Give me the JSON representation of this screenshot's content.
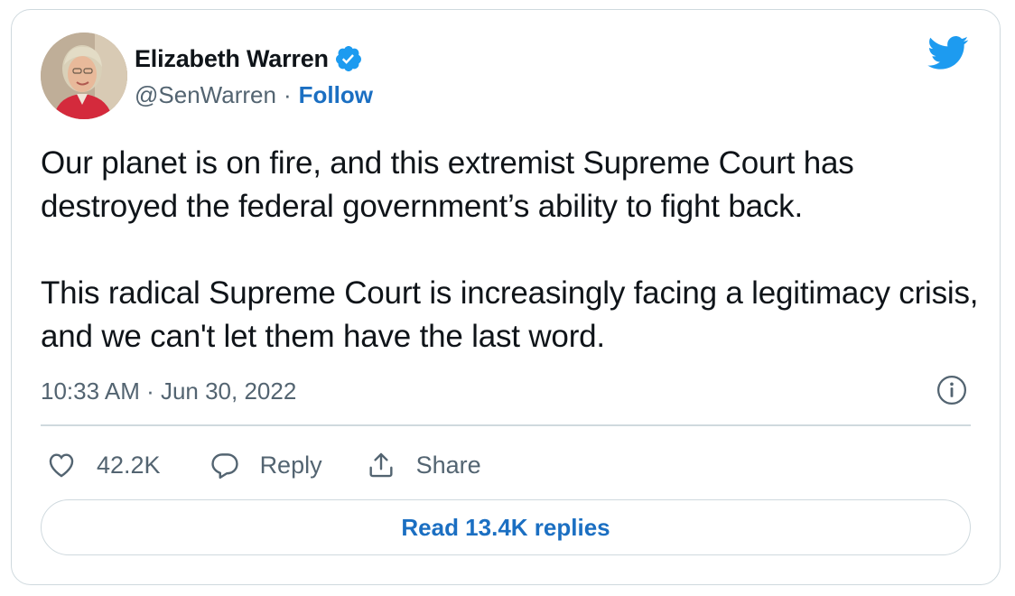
{
  "author": {
    "name": "Elizabeth Warren",
    "handle": "@SenWarren",
    "separator": "·",
    "follow_label": "Follow",
    "verified": true,
    "avatar_icon": "profile-photo"
  },
  "tweet": {
    "paragraphs": [
      "Our planet is on fire, and this extremist Supreme Court has destroyed the federal government’s ability to fight back.",
      "This radical Supreme Court is increasingly facing a legitimacy crisis, and we can't let them have the last word."
    ],
    "timestamp": "10:33 AM · Jun 30, 2022"
  },
  "actions": {
    "like_count": "42.2K",
    "reply_label": "Reply",
    "share_label": "Share"
  },
  "read_replies_label": "Read 13.4K replies",
  "colors": {
    "brand_blue": "#1d9bf0",
    "link_blue": "#1b6fc2",
    "text_primary": "#0f1419",
    "text_secondary": "#536471",
    "border": "#cfd9de"
  },
  "icons": [
    "verified-badge-icon",
    "twitter-bird-icon",
    "info-icon",
    "heart-icon",
    "reply-bubble-icon",
    "share-icon"
  ]
}
